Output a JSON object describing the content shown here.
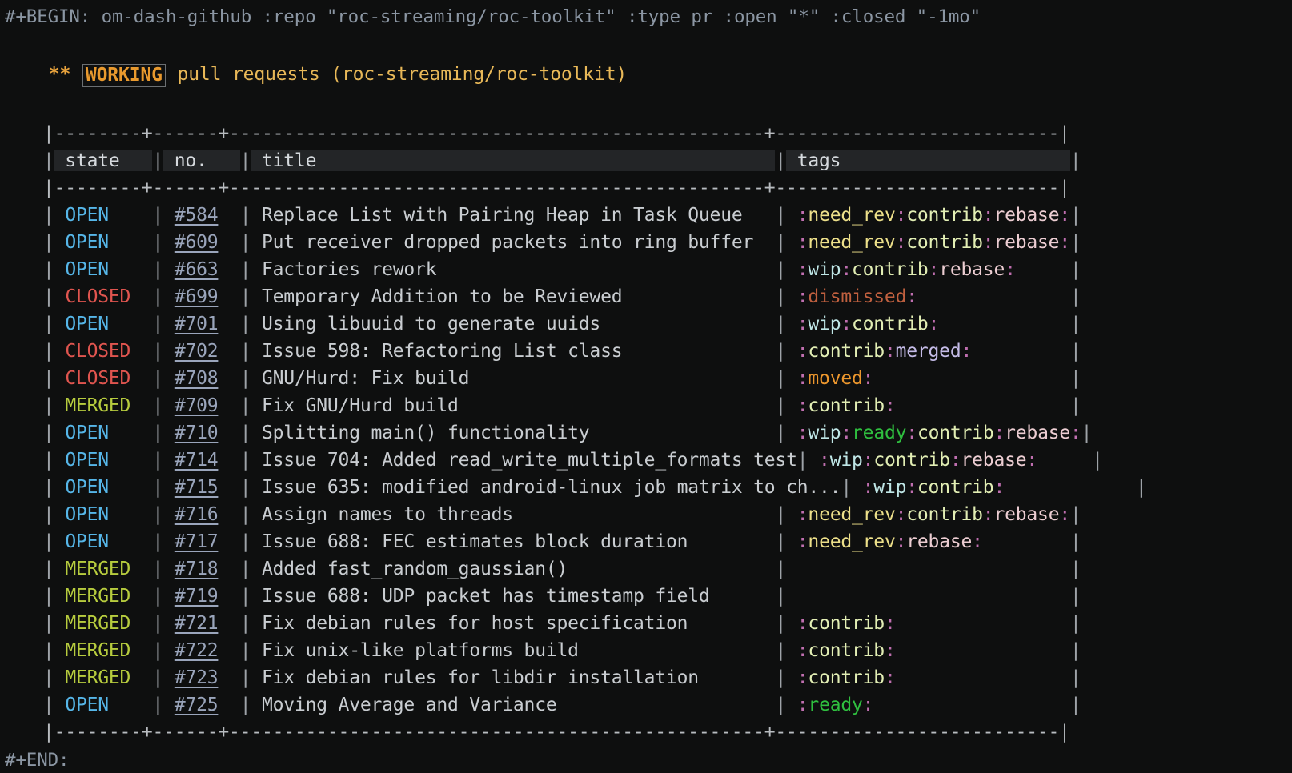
{
  "block": {
    "begin_line": "#+BEGIN: om-dash-github :repo \"roc-streaming/roc-toolkit\" :type pr :open \"*\" :closed \"-1mo\"",
    "end_line": "#+END:"
  },
  "heading": {
    "stars": "**",
    "todo_keyword": "WORKING",
    "text": "pull requests (roc-streaming/roc-toolkit)"
  },
  "table": {
    "rule": "|--------+------+-------------------------------------------------+--------------------------|",
    "columns": [
      {
        "key": "state",
        "label": "state",
        "width": 9
      },
      {
        "key": "no",
        "label": "no.",
        "width": 7
      },
      {
        "key": "title",
        "label": "title",
        "width": 48
      },
      {
        "key": "tags",
        "label": "tags",
        "width": 26
      }
    ],
    "rows": [
      {
        "state": "OPEN",
        "no": "#584",
        "title": "Replace List with Pairing Heap in Task Queue",
        "tags": [
          "need_rev",
          "contrib",
          "rebase"
        ]
      },
      {
        "state": "OPEN",
        "no": "#609",
        "title": "Put receiver dropped packets into ring buffer",
        "tags": [
          "need_rev",
          "contrib",
          "rebase"
        ]
      },
      {
        "state": "OPEN",
        "no": "#663",
        "title": "Factories rework",
        "tags": [
          "wip",
          "contrib",
          "rebase"
        ]
      },
      {
        "state": "CLOSED",
        "no": "#699",
        "title": "Temporary Addition to be Reviewed",
        "tags": [
          "dismissed"
        ]
      },
      {
        "state": "OPEN",
        "no": "#701",
        "title": "Using libuuid to generate uuids",
        "tags": [
          "wip",
          "contrib"
        ]
      },
      {
        "state": "CLOSED",
        "no": "#702",
        "title": "Issue 598: Refactoring List class",
        "tags": [
          "contrib",
          "merged"
        ]
      },
      {
        "state": "CLOSED",
        "no": "#708",
        "title": "GNU/Hurd: Fix build",
        "tags": [
          "moved"
        ]
      },
      {
        "state": "MERGED",
        "no": "#709",
        "title": "Fix GNU/Hurd build",
        "tags": [
          "contrib"
        ]
      },
      {
        "state": "OPEN",
        "no": "#710",
        "title": "Splitting main() functionality",
        "tags": [
          "wip",
          "ready",
          "contrib",
          "rebase"
        ]
      },
      {
        "state": "OPEN",
        "no": "#714",
        "title": "Issue 704: Added read_write_multiple_formats test",
        "tags": [
          "wip",
          "contrib",
          "rebase"
        ]
      },
      {
        "state": "OPEN",
        "no": "#715",
        "title": "Issue 635: modified android-linux job matrix to ch...",
        "tags": [
          "wip",
          "contrib"
        ]
      },
      {
        "state": "OPEN",
        "no": "#716",
        "title": "Assign names to threads",
        "tags": [
          "need_rev",
          "contrib",
          "rebase"
        ]
      },
      {
        "state": "OPEN",
        "no": "#717",
        "title": "Issue 688: FEC estimates block duration",
        "tags": [
          "need_rev",
          "rebase"
        ]
      },
      {
        "state": "MERGED",
        "no": "#718",
        "title": "Added fast_random_gaussian()",
        "tags": []
      },
      {
        "state": "MERGED",
        "no": "#719",
        "title": "Issue 688: UDP packet has timestamp field",
        "tags": []
      },
      {
        "state": "MERGED",
        "no": "#721",
        "title": "Fix debian rules for host specification",
        "tags": [
          "contrib"
        ]
      },
      {
        "state": "MERGED",
        "no": "#722",
        "title": "Fix unix-like platforms build",
        "tags": [
          "contrib"
        ]
      },
      {
        "state": "MERGED",
        "no": "#723",
        "title": "Fix debian rules for libdir installation",
        "tags": [
          "contrib"
        ]
      },
      {
        "state": "OPEN",
        "no": "#725",
        "title": "Moving Average and Variance",
        "tags": [
          "ready"
        ]
      }
    ]
  },
  "colors": {
    "background": "#0e0f0f",
    "open": "#56b6e8",
    "closed": "#e0554f",
    "merged": "#b7cc3e",
    "link": "#9aa5bb",
    "heading": "#e8b858",
    "todo": "#e8992e",
    "tag_need_rev": "#ede08a",
    "tag_contrib": "#e2eeb4",
    "tag_rebase": "#eccdd2",
    "tag_wip": "#bfe6e6",
    "tag_dismissed": "#c0603f",
    "tag_merged": "#c5bce8",
    "tag_moved": "#eb962d",
    "tag_ready": "#2fbf3f",
    "tag_separator": "#c06fb0"
  }
}
